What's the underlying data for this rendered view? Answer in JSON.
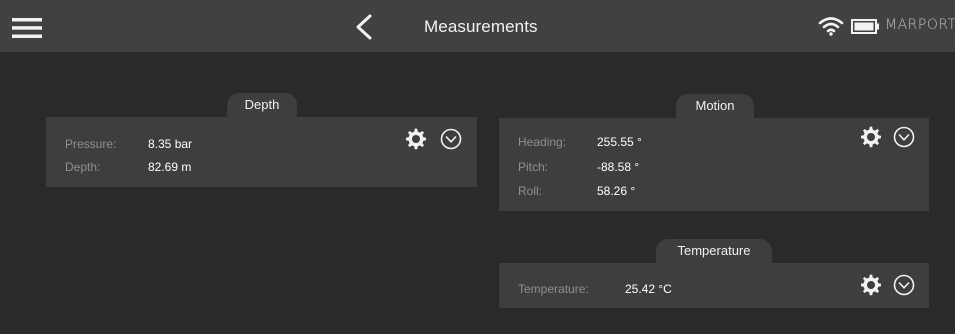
{
  "header": {
    "title": "Measurements",
    "menu_icon": "hamburger-menu-icon",
    "back_icon": "chevron-left-icon",
    "status_icons": [
      "wifi-icon",
      "battery-icon"
    ],
    "brand": "MARPORT"
  },
  "panels": {
    "depth": {
      "title": "Depth",
      "rows": [
        {
          "label": "Pressure:",
          "value": "8.35 bar"
        },
        {
          "label": "Depth:",
          "value": "82.69 m"
        }
      ]
    },
    "motion": {
      "title": "Motion",
      "rows": [
        {
          "label": "Heading:",
          "value": "255.55 °"
        },
        {
          "label": "Pitch:",
          "value": "-88.58 °"
        },
        {
          "label": "Roll:",
          "value": "58.26 °"
        }
      ]
    },
    "temperature": {
      "title": "Temperature",
      "rows": [
        {
          "label": "Temperature:",
          "value": "25.42 °C"
        }
      ]
    }
  },
  "colors": {
    "background": "#2a2a2a",
    "topbar": "#414141",
    "panel": "#3e3e3e",
    "label": "#8f8f8f",
    "value": "#ffffff"
  }
}
